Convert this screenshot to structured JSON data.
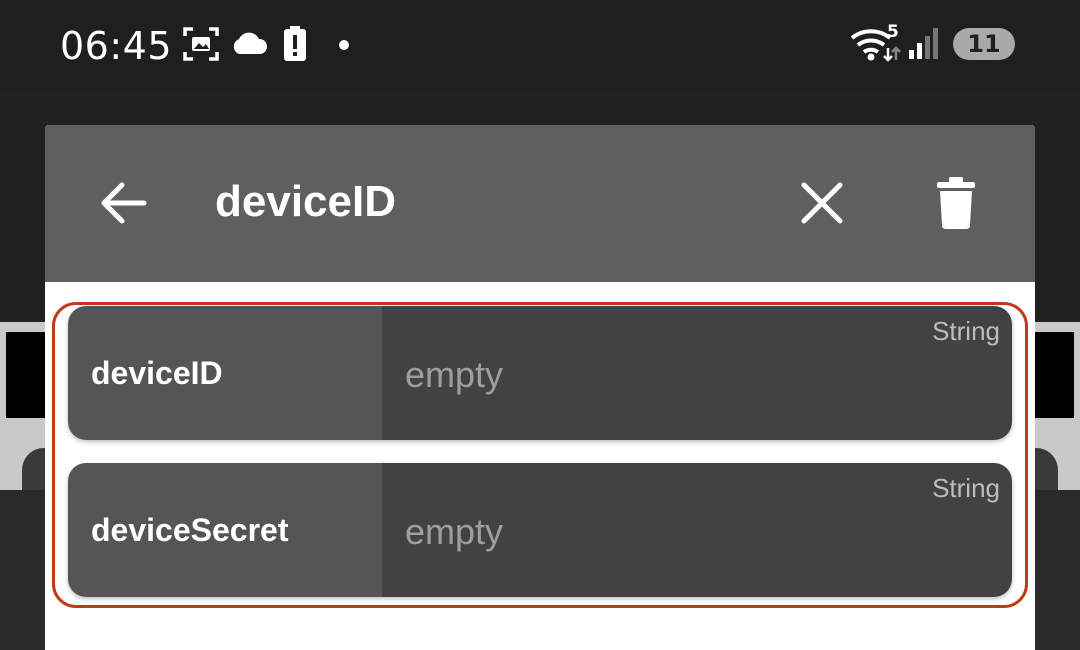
{
  "status_bar": {
    "time": "06:45",
    "battery_level": "11",
    "wifi_badge": "5",
    "icons": [
      "screenshot-icon",
      "cloud-icon",
      "battery-alert-icon",
      "dot-icon",
      "wifi-icon",
      "signal-icon"
    ]
  },
  "dialog": {
    "title": "deviceID",
    "actions": [
      "back-arrow-icon",
      "close-icon",
      "delete-icon"
    ],
    "fields": [
      {
        "name": "deviceID",
        "type": "String",
        "placeholder": "empty"
      },
      {
        "name": "deviceSecret",
        "type": "String",
        "placeholder": "empty"
      }
    ]
  },
  "colors": {
    "header": "#5f5f5f",
    "highlight": "#c0391b",
    "field_name_bg": "#555555",
    "field_value_bg": "#424242"
  }
}
